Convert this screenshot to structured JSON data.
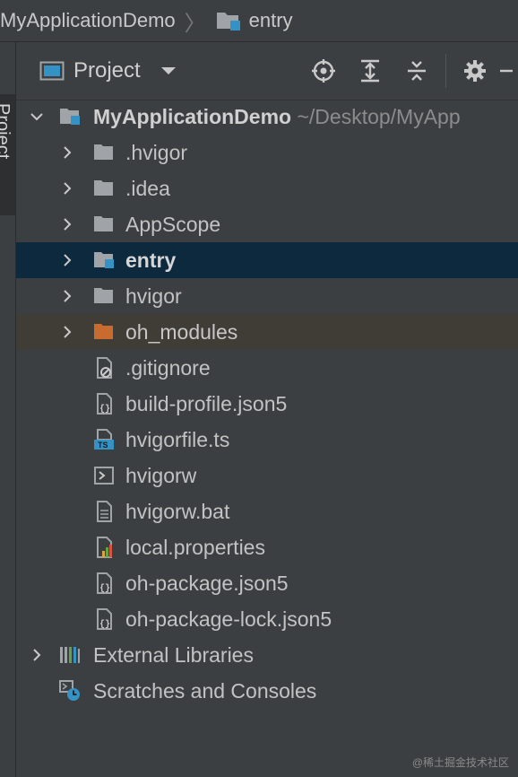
{
  "breadcrumb": [
    {
      "label": "MyApplicationDemo"
    },
    {
      "label": "entry"
    }
  ],
  "stripe": {
    "label": "Project"
  },
  "toolbar": {
    "title": "Project",
    "actions": [
      "locate-icon",
      "expand-all-icon",
      "collapse-all-icon",
      "gear-icon",
      "hide-icon"
    ]
  },
  "tree": {
    "root": {
      "name": "MyApplicationDemo",
      "path": "~/Desktop/MyApp"
    },
    "items": [
      {
        "name": ".hvigor",
        "icon": "folder-icon"
      },
      {
        "name": ".idea",
        "icon": "folder-icon"
      },
      {
        "name": "AppScope",
        "icon": "folder-icon"
      },
      {
        "name": "entry",
        "icon": "module-folder-icon"
      },
      {
        "name": "hvigor",
        "icon": "folder-icon"
      },
      {
        "name": "oh_modules",
        "icon": "excluded-folder-icon"
      },
      {
        "name": ".gitignore",
        "icon": "ignore-file-icon"
      },
      {
        "name": "build-profile.json5",
        "icon": "json-file-icon"
      },
      {
        "name": "hvigorfile.ts",
        "icon": "typescript-file-icon"
      },
      {
        "name": "hvigorw",
        "icon": "shell-file-icon"
      },
      {
        "name": "hvigorw.bat",
        "icon": "text-file-icon"
      },
      {
        "name": "local.properties",
        "icon": "properties-file-icon"
      },
      {
        "name": "oh-package.json5",
        "icon": "json-file-icon"
      },
      {
        "name": "oh-package-lock.json5",
        "icon": "json-file-icon"
      }
    ],
    "external": "External Libraries",
    "scratches": "Scratches and Consoles"
  },
  "colors": {
    "background": "#3c3f41",
    "selection": "#0d293e",
    "excluded": "#403d37",
    "accent_blue": "#3592c4",
    "folder_orange": "#c86b2f"
  },
  "watermark": "@稀土掘金技术社区"
}
